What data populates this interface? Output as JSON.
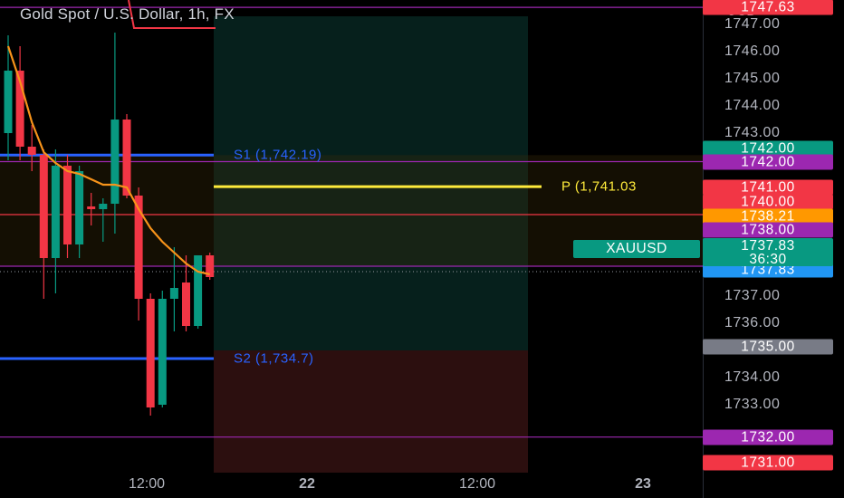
{
  "header": {
    "title": "Gold Spot / U.S. Dollar, 1h, FX",
    "currency": "USD"
  },
  "colors": {
    "background": "#000000",
    "candle_up": "#089981",
    "candle_down": "#f23645",
    "ma_line": "#f7931a",
    "support_line": "#2962ff",
    "pivot_line": "#ffeb3b",
    "level_purple": "#9c27b0",
    "level_red": "#f23645",
    "level_green": "#089981",
    "level_orange": "#ff9800",
    "level_blue": "#2196f3",
    "level_gray": "#787b86"
  },
  "chart_data": {
    "type": "candlestick",
    "title": "Gold Spot / U.S. Dollar, 1h, FX",
    "symbol": "XAUUSD",
    "timeframe": "1h",
    "y_unit": "USD",
    "ylim": [
      1730.5,
      1747.9
    ],
    "y_ticks": [
      "1747.00",
      "1746.00",
      "1745.00",
      "1744.00",
      "1743.00",
      "1737.00",
      "1736.00",
      "1734.00",
      "1733.00"
    ],
    "x_ticks": [
      "12:00",
      "22",
      "12:00",
      "23"
    ],
    "candles": [
      {
        "o": 1743.0,
        "h": 1746.6,
        "l": 1742.0,
        "c": 1745.3
      },
      {
        "o": 1745.3,
        "h": 1746.2,
        "l": 1742.0,
        "c": 1742.5
      },
      {
        "o": 1742.5,
        "h": 1743.3,
        "l": 1741.6,
        "c": 1742.2
      },
      {
        "o": 1742.2,
        "h": 1742.4,
        "l": 1736.9,
        "c": 1738.4
      },
      {
        "o": 1738.4,
        "h": 1742.4,
        "l": 1737.1,
        "c": 1741.8
      },
      {
        "o": 1741.8,
        "h": 1742.2,
        "l": 1738.4,
        "c": 1738.9
      },
      {
        "o": 1738.9,
        "h": 1741.8,
        "l": 1738.4,
        "c": 1741.6
      },
      {
        "o": 1740.3,
        "h": 1740.8,
        "l": 1739.6,
        "c": 1740.2
      },
      {
        "o": 1740.2,
        "h": 1740.6,
        "l": 1739.0,
        "c": 1740.4
      },
      {
        "o": 1740.4,
        "h": 1746.7,
        "l": 1739.3,
        "c": 1743.5
      },
      {
        "o": 1743.5,
        "h": 1743.7,
        "l": 1740.6,
        "c": 1740.7
      },
      {
        "o": 1740.7,
        "h": 1741.0,
        "l": 1736.1,
        "c": 1736.9
      },
      {
        "o": 1736.9,
        "h": 1737.1,
        "l": 1732.6,
        "c": 1732.9
      },
      {
        "o": 1733.0,
        "h": 1737.2,
        "l": 1732.9,
        "c": 1736.9
      },
      {
        "o": 1736.9,
        "h": 1738.8,
        "l": 1735.7,
        "c": 1737.3
      },
      {
        "o": 1737.5,
        "h": 1738.5,
        "l": 1735.7,
        "c": 1735.9
      },
      {
        "o": 1735.9,
        "h": 1738.5,
        "l": 1735.8,
        "c": 1738.5
      },
      {
        "o": 1738.5,
        "h": 1738.6,
        "l": 1737.6,
        "c": 1737.7
      }
    ],
    "moving_average": [
      1746.2,
      1744.9,
      1743.4,
      1742.3,
      1741.9,
      1741.6,
      1741.5,
      1741.3,
      1741.1,
      1741.1,
      1741.0,
      1740.2,
      1739.5,
      1739.0,
      1738.6,
      1738.2,
      1737.9,
      1737.8
    ],
    "levels": [
      {
        "name": "S1",
        "label": "S1 (1,742.19)",
        "value": 1742.19,
        "style": "support"
      },
      {
        "name": "P",
        "label": "P (1,741.03",
        "value": 1741.03,
        "style": "pivot"
      },
      {
        "name": "S2",
        "label": "S2 (1,734.7)",
        "value": 1734.7,
        "style": "support"
      }
    ],
    "price_tags": [
      {
        "text": "1747.63",
        "value": 1747.63,
        "color": "#f23645"
      },
      {
        "text": "1742.00",
        "value": 1742.42,
        "color": "#089981"
      },
      {
        "text": "1742.00",
        "value": 1741.95,
        "color": "#9c27b0"
      },
      {
        "text": "1741.00",
        "value": 1741.0,
        "color": "#f23645"
      },
      {
        "text": "1740.00",
        "value": 1740.47,
        "color": "#f23645"
      },
      {
        "text": "1738.21",
        "value": 1739.95,
        "color": "#ff9800"
      },
      {
        "text": "1738.00",
        "value": 1739.44,
        "color": "#9c27b0"
      },
      {
        "text": "1737.83",
        "value": 1737.98,
        "color": "#2196f3"
      },
      {
        "text": "1735.00",
        "value": 1735.14,
        "color": "#787b86"
      },
      {
        "text": "1732.00",
        "value": 1731.81,
        "color": "#9c27b0"
      },
      {
        "text": "1731.00",
        "value": 1730.88,
        "color": "#f23645"
      }
    ],
    "last_price": {
      "symbol": "XAUUSD",
      "price": "1737.83",
      "countdown": "36:30",
      "value": 1738.77
    },
    "horizontal_lines": [
      {
        "value": 1747.63,
        "color": "#9c27b0"
      },
      {
        "value": 1741.95,
        "color": "#9c27b0"
      },
      {
        "value": 1740.0,
        "color": "#f23645"
      },
      {
        "value": 1738.1,
        "color": "#9c27b0"
      },
      {
        "value": 1731.81,
        "color": "#9c27b0"
      }
    ],
    "projection": {
      "profit_top": 1747.3,
      "entry": 1735.0,
      "loss_bottom": 1730.5,
      "profit_color": "#0b3b33",
      "loss_color": "#3b1414"
    }
  }
}
